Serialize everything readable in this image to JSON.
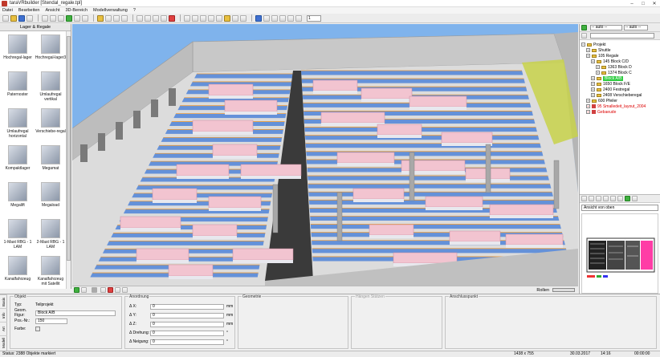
{
  "window": {
    "title": "taraVRbuilder [Stendal_regale.tpl]"
  },
  "menu": [
    "Datei",
    "Bearbeiten",
    "Ansicht",
    "3D-Bereich",
    "Modellverwaltung",
    "?"
  ],
  "toolbar": {
    "page_value": "1"
  },
  "library": {
    "header": "Lager & Regale",
    "items": [
      {
        "label": "Hochregal-lager",
        "col": 0,
        "row": 0
      },
      {
        "label": "Hochregal-lager3",
        "col": 1,
        "row": 0
      },
      {
        "label": "Paternoster",
        "col": 0,
        "row": 1
      },
      {
        "label": "Umlaufregal vertikal",
        "col": 1,
        "row": 1
      },
      {
        "label": "Umlaufregal horizontal",
        "col": 0,
        "row": 2
      },
      {
        "label": "Verschiebe-regal",
        "col": 1,
        "row": 2
      },
      {
        "label": "Kompaktlager",
        "col": 0,
        "row": 3
      },
      {
        "label": "Megamat",
        "col": 1,
        "row": 3
      },
      {
        "label": "Megalift",
        "col": 0,
        "row": 4
      },
      {
        "label": "Megaload",
        "col": 1,
        "row": 4
      },
      {
        "label": "1-Mast RBG - 1 LAM",
        "col": 0,
        "row": 5
      },
      {
        "label": "2-Mast RBG - 1 LAM",
        "col": 1,
        "row": 5
      },
      {
        "label": "Kanalfahrzeug",
        "col": 0,
        "row": 6
      },
      {
        "label": "Kanalfahrzeug mit Satellit",
        "col": 1,
        "row": 6
      }
    ]
  },
  "viewport": {
    "zoom_label": "Rollen"
  },
  "tree_panel": {
    "filter1": "-- auto --",
    "filter2": "-- auto --",
    "nodes": [
      {
        "label": "Projekt",
        "indent": 0,
        "kind": "root"
      },
      {
        "label": "Shuttle",
        "indent": 1,
        "kind": "folder"
      },
      {
        "label": "105 Regale",
        "indent": 1,
        "kind": "folder"
      },
      {
        "label": "145 Block C/D",
        "indent": 2,
        "kind": "folder"
      },
      {
        "label": "1363 Block D",
        "indent": 3,
        "kind": "folder"
      },
      {
        "label": "1374 Block C",
        "indent": 3,
        "kind": "folder"
      },
      {
        "label": "Block A/B",
        "indent": 2,
        "kind": "selected"
      },
      {
        "label": "1650 Block F/E",
        "indent": 2,
        "kind": "folder"
      },
      {
        "label": "2400 Festregal",
        "indent": 2,
        "kind": "folder"
      },
      {
        "label": "2408 Verschieberegal",
        "indent": 2,
        "kind": "folder"
      },
      {
        "label": "600 Pfeiler",
        "indent": 1,
        "kind": "folder"
      },
      {
        "label": "95 Smalledeit_layout_2004",
        "indent": 1,
        "kind": "red"
      },
      {
        "label": "Gebaeude",
        "indent": 1,
        "kind": "red"
      }
    ],
    "view_select": "Ansicht von oben"
  },
  "properties": {
    "side_tabs": [
      "Basis",
      "Info",
      "Art",
      "Modell"
    ],
    "objekt": {
      "title": "Objekt",
      "fields": [
        {
          "label": "Typ:",
          "value": "Teilprojekt"
        },
        {
          "label": "Geom. Figur:",
          "value": "Block A/B"
        },
        {
          "label": "Pos.-Nr.:",
          "value": "150"
        },
        {
          "label": "Farbe:",
          "value": ""
        }
      ]
    },
    "anordnung": {
      "title": "Anordnung",
      "fields": [
        {
          "label": "Δ X:",
          "value": "0",
          "unit": "mm"
        },
        {
          "label": "Δ Y:",
          "value": "0",
          "unit": "mm"
        },
        {
          "label": "Δ Z:",
          "value": "0",
          "unit": "mm"
        },
        {
          "label": "Δ Drehung:",
          "value": "0",
          "unit": "°"
        },
        {
          "label": "Δ Neigung:",
          "value": "0",
          "unit": "°"
        }
      ]
    },
    "geometrie": {
      "title": "Geometrie"
    },
    "haengen": {
      "title": "Hängen  Stützen"
    },
    "anschluss": {
      "title": "Anschlusspunkt"
    }
  },
  "status": {
    "text": "Status: 2388 Objekte markiert",
    "size": "1438 x 755",
    "date": "30.03.2017",
    "time": "14:16",
    "clock": "00:00:00"
  },
  "colors": {
    "sky": "#7fb3ec",
    "floor": "#dcdcdc",
    "rack_blue": "#3c78d8",
    "beam_orange": "#e89a3c",
    "pallet_pink": "#f2c4d0",
    "selected_green": "#2ecc40"
  }
}
